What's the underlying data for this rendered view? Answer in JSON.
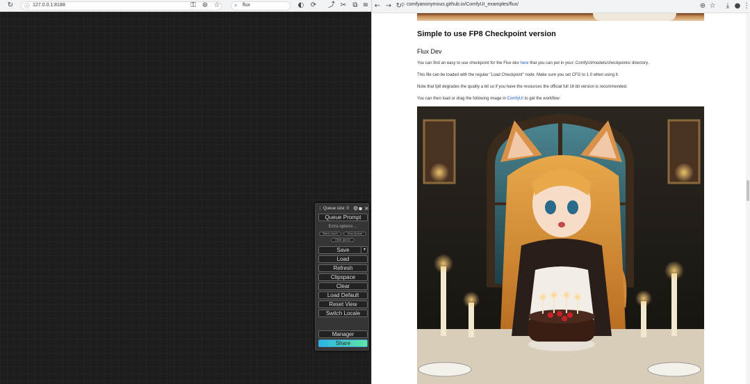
{
  "left_window": {
    "address": "127.0.0.1:8188",
    "search_text": "flux",
    "menu": {
      "queue_size": "Queue size: 0",
      "queue_prompt": "Queue Prompt",
      "extra_options": "Extra options ...",
      "chips": [
        "Batch count",
        "Auto Queue",
        "Clear queue"
      ],
      "buttons": {
        "save": "Save",
        "save_arrow": "▾",
        "load": "Load",
        "refresh": "Refresh",
        "clipspace": "Clipspace",
        "clear": "Clear",
        "load_default": "Load Default",
        "reset_view": "Reset View",
        "switch_locale": "Switch Locale",
        "manager": "Manager",
        "share": "Share"
      }
    }
  },
  "right_window": {
    "url": "comfyanonymous.github.io/ComfyUI_examples/flux/",
    "article": {
      "heading": "Simple to use FP8 Checkpoint version",
      "subheading": "Flux Dev",
      "p1_before": "You can find an easy to use checkpoint for the Flux dev ",
      "p1_link": "here",
      "p1_after": " that you can put in your: ComfyUI/models/checkpoints/ directory.",
      "p2": "This file can be loaded with the regular \"Load Checkpoint\" node. Make sure you set CFG to 1.0 when using it.",
      "p3": "Note that fp8 degrades the quality a bit so if you have the resources the official full 16 bit version is recommended.",
      "p4_before": "You can then load or drag the following image in ",
      "p4_link": "ComfyUI",
      "p4_after": " to get the workflow:"
    }
  },
  "colors": {
    "canvas": "#1d1d1d",
    "menu": "#353535",
    "link": "#1a5dbf",
    "share_gradient_start": "#2ab4e6",
    "share_gradient_end": "#5fe6a5"
  }
}
